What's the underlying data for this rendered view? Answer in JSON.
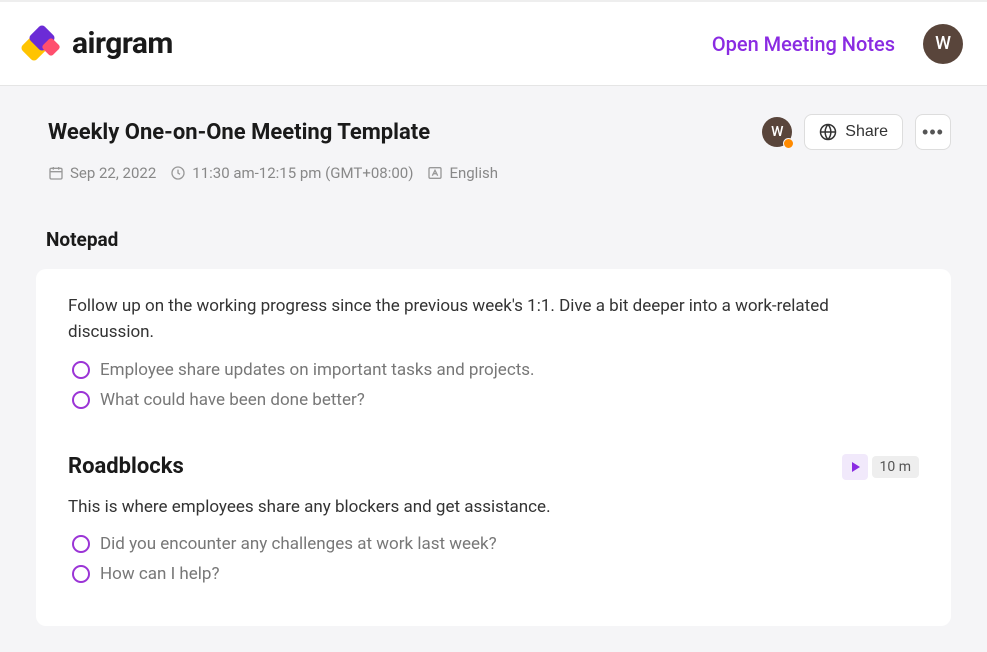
{
  "header": {
    "logo_text": "airgram",
    "open_notes_label": "Open Meeting Notes",
    "avatar_letter": "W"
  },
  "page": {
    "title": "Weekly One-on-One Meeting Template",
    "small_avatar_letter": "W",
    "share_label": "Share",
    "meta": {
      "date": "Sep 22, 2022",
      "time": "11:30 am-12:15 pm (GMT+08:00)",
      "language": "English"
    }
  },
  "notepad": {
    "title": "Notepad",
    "intro": "Follow up on the working progress since the previous week's 1:1. Dive a bit deeper into a work-related discussion.",
    "items": [
      "Employee share updates on important tasks and projects.",
      "What could have been done better?"
    ],
    "section2": {
      "title": "Roadblocks",
      "duration": "10 m",
      "intro": "This is where employees share any blockers and get assistance.",
      "items": [
        "Did you encounter any challenges at work last week?",
        "How can I help?"
      ]
    }
  }
}
